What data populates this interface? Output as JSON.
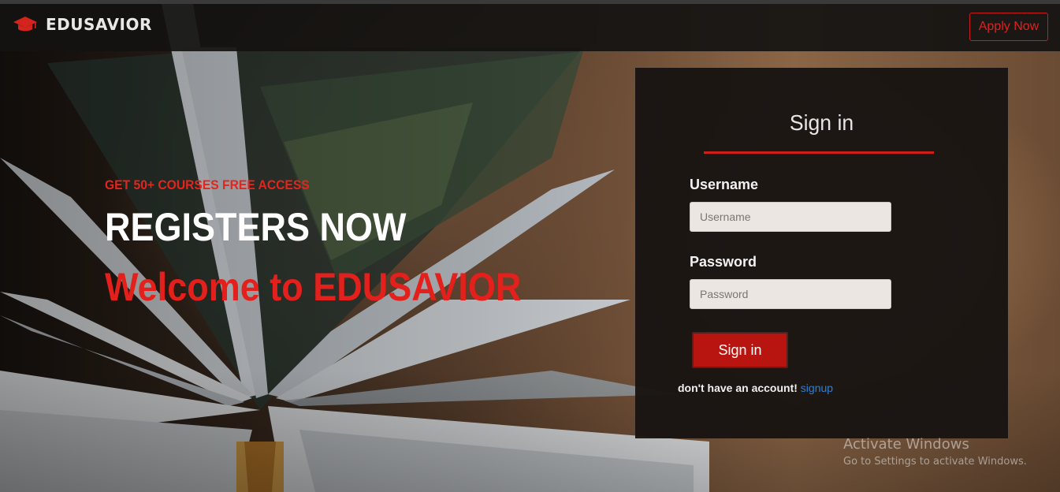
{
  "navbar": {
    "brand": "EDUSAVIOR",
    "brand_icon": "graduation-cap-icon",
    "apply_label": "Apply Now"
  },
  "hero": {
    "subtitle": "GET 50+ COURSES FREE ACCESS",
    "title": "REGISTERS NOW",
    "welcome": "Welcome to EDUSAVIOR"
  },
  "signin": {
    "heading": "Sign in",
    "username_label": "Username",
    "username_placeholder": "Username",
    "password_label": "Password",
    "password_placeholder": "Password",
    "submit_label": "Sign in",
    "no_account_text": "don't have an account!",
    "signup_label": "signup"
  },
  "watermark": {
    "title": "Activate Windows",
    "subtitle": "Go to Settings to activate Windows."
  },
  "colors": {
    "accent_red": "#e0261e",
    "button_red": "#b81510",
    "link_blue": "#2d7fd6",
    "card_bg": "#181412"
  }
}
